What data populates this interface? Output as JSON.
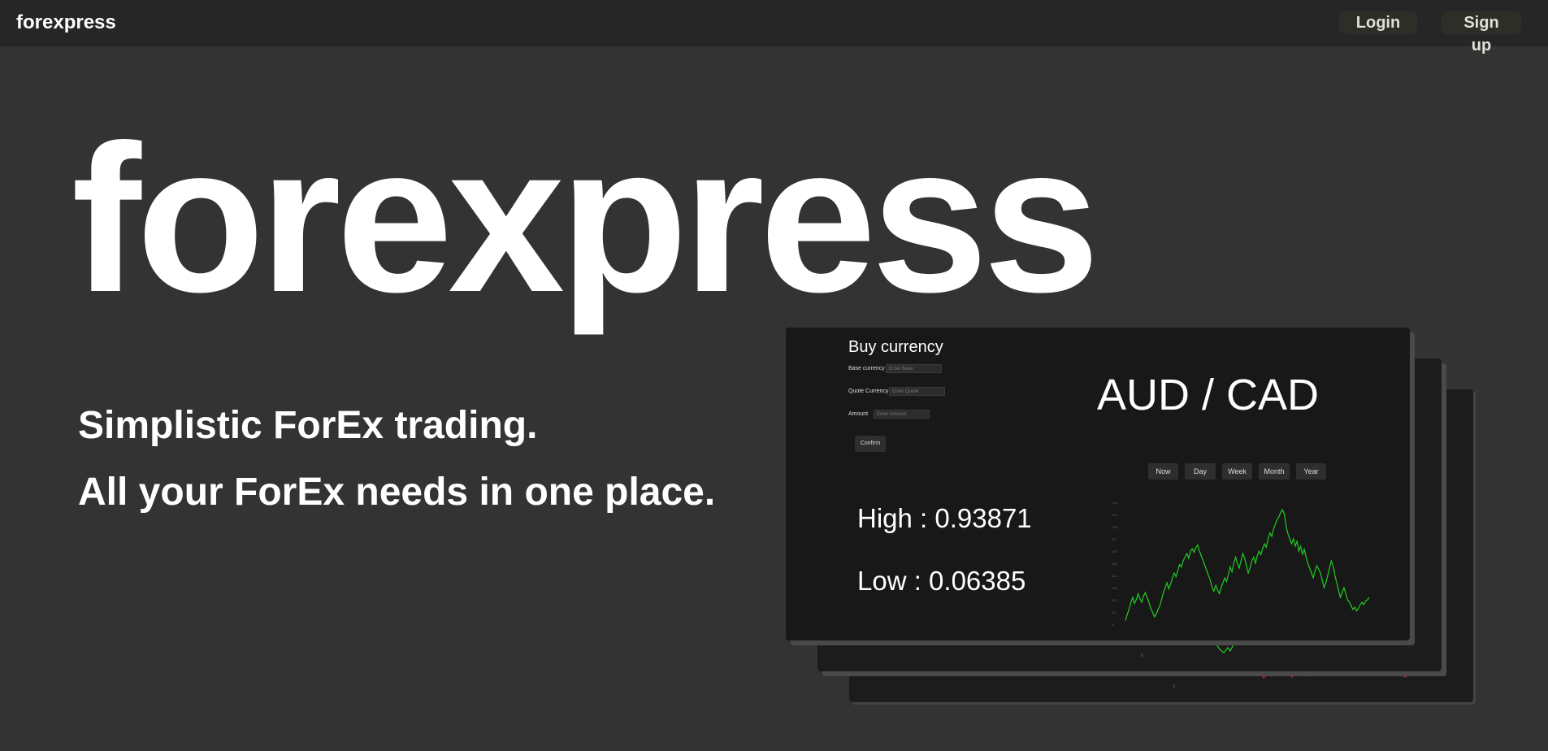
{
  "nav": {
    "brand": "forexpress",
    "login_label": "Login",
    "signup_label": "Sign up"
  },
  "hero": {
    "title": "forexpress",
    "tagline_1": "Simplistic ForEx trading.",
    "tagline_2": "All your ForEx needs in one place."
  },
  "preview": {
    "buy_title": "Buy currency",
    "form": {
      "base_label": "Base currency",
      "base_placeholder": "Enter Base",
      "quote_label": "Quote Currency",
      "quote_placeholder": "Enter Quote",
      "amount_label": "Amount",
      "amount_placeholder": "Enter Amount",
      "confirm_label": "Confirm"
    },
    "pair": "AUD / CAD",
    "ranges": [
      "Now",
      "Day",
      "Week",
      "Month",
      "Year"
    ],
    "high_text": "High : 0.93871",
    "low_text": "Low : 0.06385"
  },
  "colors": {
    "background": "#333333",
    "navbar": "#262626",
    "card": "#181818",
    "line_up": "#22cc22",
    "line_down": "#cc2222"
  },
  "chart_data": {
    "type": "line",
    "series": [
      {
        "color": "#22cc22",
        "values": [
          0.03,
          0.08,
          0.12,
          0.18,
          0.22,
          0.17,
          0.2,
          0.25,
          0.21,
          0.18,
          0.23,
          0.26,
          0.22,
          0.18,
          0.13,
          0.1,
          0.06,
          0.08,
          0.12,
          0.15,
          0.2,
          0.26,
          0.3,
          0.34,
          0.29,
          0.33,
          0.38,
          0.42,
          0.39,
          0.44,
          0.49,
          0.47,
          0.52,
          0.55,
          0.58,
          0.54,
          0.6,
          0.62,
          0.59,
          0.63,
          0.65,
          0.6,
          0.56,
          0.52,
          0.48,
          0.44,
          0.4,
          0.36,
          0.3,
          0.27,
          0.32,
          0.28,
          0.25,
          0.3,
          0.34,
          0.38,
          0.35,
          0.41,
          0.47,
          0.43,
          0.5,
          0.55,
          0.5,
          0.46,
          0.52,
          0.58,
          0.54,
          0.48,
          0.42,
          0.46,
          0.52,
          0.55,
          0.5,
          0.56,
          0.6,
          0.57,
          0.62,
          0.66,
          0.63,
          0.7,
          0.75,
          0.72,
          0.78,
          0.82,
          0.86,
          0.88,
          0.92,
          0.94,
          0.9,
          0.8,
          0.74,
          0.7,
          0.66,
          0.7,
          0.64,
          0.68,
          0.6,
          0.64,
          0.57,
          0.62,
          0.55,
          0.5,
          0.46,
          0.42,
          0.38,
          0.44,
          0.48,
          0.45,
          0.42,
          0.36,
          0.3,
          0.34,
          0.4,
          0.46,
          0.52,
          0.48,
          0.4,
          0.34,
          0.28,
          0.22,
          0.26,
          0.3,
          0.25,
          0.2,
          0.18,
          0.15,
          0.12,
          0.14,
          0.11,
          0.13,
          0.16,
          0.18,
          0.16,
          0.19,
          0.2,
          0.22
        ]
      }
    ],
    "ylim": [
      0,
      1
    ],
    "yticks": [
      "0",
      "0.1",
      "0.2",
      "0.3",
      "0.4",
      "0.5",
      "0.6",
      "0.7",
      "0.8",
      "0.9",
      "1.0"
    ]
  }
}
